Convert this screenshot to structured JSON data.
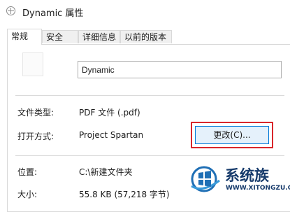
{
  "window": {
    "title": "Dynamic 属性"
  },
  "tabs": [
    {
      "label": "常规"
    },
    {
      "label": "安全"
    },
    {
      "label": "详细信息"
    },
    {
      "label": "以前的版本"
    }
  ],
  "general": {
    "file_name": "Dynamic",
    "file_type_label": "文件类型:",
    "file_type_value": "PDF 文件 (.pdf)",
    "open_with_label": "打开方式:",
    "open_with_value": "Project Spartan",
    "change_button": "更改(C)...",
    "location_label": "位置:",
    "location_value": "C:\\新建文件夹",
    "size_label": "大小:",
    "size_value": "55.8 KB (57,218 字节)"
  },
  "watermark": {
    "brand": "系统族",
    "url": "WWW.XITONGZU.COM"
  },
  "colors": {
    "highlight": "#d9262b",
    "button_border": "#0078d7",
    "button_fill": "#e5f1fb",
    "watermark": "#163a6b"
  }
}
